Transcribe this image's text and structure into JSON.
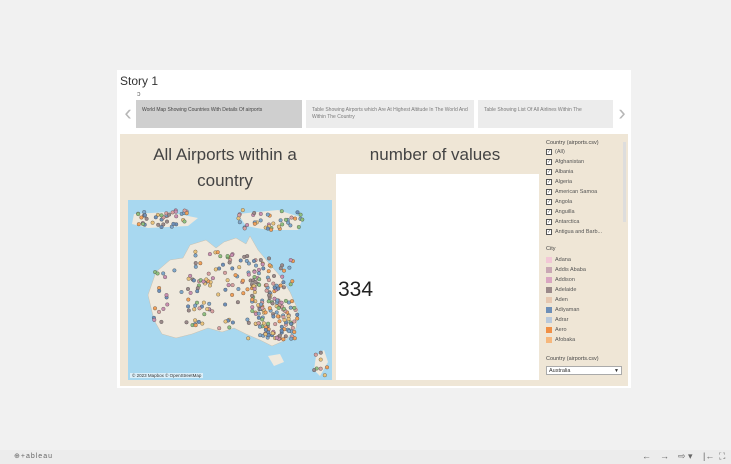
{
  "story": {
    "title": "Story 1",
    "marker": "ↄ"
  },
  "nav": {
    "prev": "‹",
    "next": "›"
  },
  "points": [
    {
      "label": "World Map Showing Countries With Details Of airports"
    },
    {
      "label": "Table Showing Airports which Are At Highest Altitude In The World And Within The Country"
    },
    {
      "label": "Table Showing List Of All Airlines Within The"
    }
  ],
  "sheets": {
    "map_title": "All Airports within a country",
    "count_title": "number of values",
    "count_value": "334"
  },
  "map": {
    "attribution": "© 2023 Mapbox © OpenStreetMap"
  },
  "filters": {
    "country_title": "Country (airports.csv)",
    "countries": [
      "(All)",
      "Afghanistan",
      "Albania",
      "Algeria",
      "American Samoa",
      "Angola",
      "Anguilla",
      "Antarctica",
      "Antigua and Barb..."
    ],
    "city_title": "City",
    "cities": [
      {
        "name": "Adana",
        "color": "#f2c7d6"
      },
      {
        "name": "Addis Ababa",
        "color": "#c9a7b4"
      },
      {
        "name": "Addison",
        "color": "#d9a6c1"
      },
      {
        "name": "Adelaide",
        "color": "#9b8a8a"
      },
      {
        "name": "Aden",
        "color": "#e6c7b0"
      },
      {
        "name": "Adiyaman",
        "color": "#6d8fb8"
      },
      {
        "name": "Adrar",
        "color": "#b7c8dc"
      },
      {
        "name": "Aero",
        "color": "#f08f45"
      },
      {
        "name": "Afobaka",
        "color": "#f6b77c"
      }
    ],
    "param_title": "Country (airports.csv)",
    "param_value": "Australia"
  },
  "footer": {
    "brand": "⊕+ableau",
    "tools": [
      "←",
      "→",
      "⇨ ▾",
      "|←",
      "⛶"
    ]
  },
  "colors": {
    "background": "#f1f1f1",
    "dashboard": "#efe6d6",
    "ocean": "#a8d8f0",
    "land": "#efe9dd"
  }
}
